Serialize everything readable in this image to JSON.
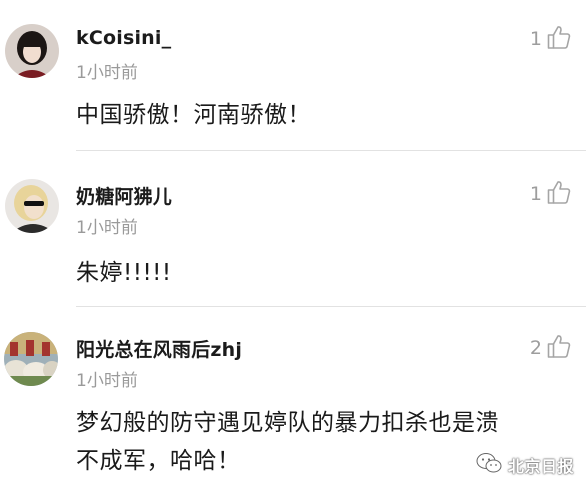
{
  "comments": [
    {
      "username": "kCoisini_",
      "time": "1小时前",
      "text": "中国骄傲！河南骄傲！",
      "likes": "1"
    },
    {
      "username": "奶糖阿狒儿",
      "time": "1小时前",
      "text": "朱婷!!!!!",
      "likes": "1"
    },
    {
      "username": "阳光总在风雨后zhj",
      "time": "1小时前",
      "text_line1": "梦幻般的防守遇见婷队的暴力扣杀也是溃",
      "text_line2": "不成军，哈哈！",
      "likes": "2"
    }
  ],
  "watermark": {
    "text": "北京日报",
    "icon": "wechat-icon"
  },
  "colors": {
    "username": "#1b1b1b",
    "time": "#9a9a9a",
    "like": "#9d9d9d",
    "divider": "#e2e2e2"
  }
}
